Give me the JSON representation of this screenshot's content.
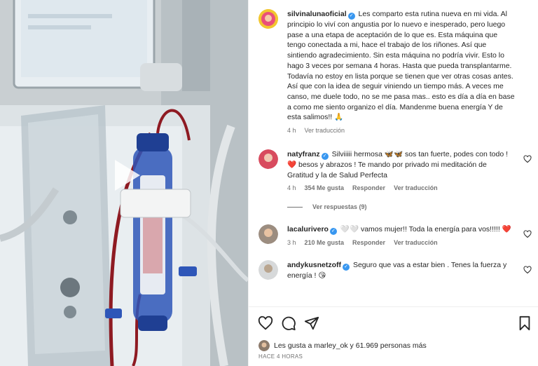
{
  "post": {
    "author": "silvinalunaoficial",
    "caption": "Les comparto esta rutina nueva en mi vida. Al principio lo viví con angustia por lo nuevo e inesperado, pero luego pase a una etapa de aceptación de lo que es. Esta máquina que tengo conectada a mi, hace el trabajo de los riñones. Así que sintiendo agradecimiento. Sin esta máquina no podría vivir. Esto lo hago 3 veces por semana 4 horas. Hasta que pueda transplantarme. Todavía no estoy en lista porque se tienen que ver otras cosas antes. Así que con la idea de seguir viniendo un tiempo más. A veces me canso, me duele todo, no se me pasa mas.. esto es día a día en base a como me siento organizo el día. Mandenme buena energía Y de esta salimos!! 🙏",
    "time": "4 h",
    "translate": "Ver traducción"
  },
  "comments": [
    {
      "user": "natyfranz",
      "text": "Silviiiii hermosa 🦋🦋 sos tan fuerte, podes con todo ! ❤️ besos y abrazos ! Te mando por privado mi meditación de Gratitud y la de Salud Perfecta",
      "time": "4 h",
      "likes": "354 Me gusta",
      "reply": "Responder",
      "translate": "Ver traducción",
      "view_replies": "Ver respuestas (9)"
    },
    {
      "user": "lacalurivero",
      "text": "🤍🤍 vamos mujer!! Toda la energía para vos!!!!! ❤️",
      "time": "3 h",
      "likes": "210 Me gusta",
      "reply": "Responder",
      "translate": "Ver traducción"
    },
    {
      "user": "andykusnetzoff",
      "text": "Seguro que vas a estar bien . Tenes la fuerza y energía ! 😘"
    }
  ],
  "footer": {
    "likes_text": "Les gusta a marley_ok y 61.969 personas más",
    "ago": "HACE 4 HORAS"
  },
  "icons": {
    "like": "heart-icon",
    "comment": "comment-icon",
    "share": "paper-plane-icon",
    "save": "bookmark-icon",
    "play": "play-icon",
    "verified": "verified-badge-icon"
  },
  "colors": {
    "verified": "#3897f0",
    "text": "#262626",
    "muted": "#737373"
  }
}
